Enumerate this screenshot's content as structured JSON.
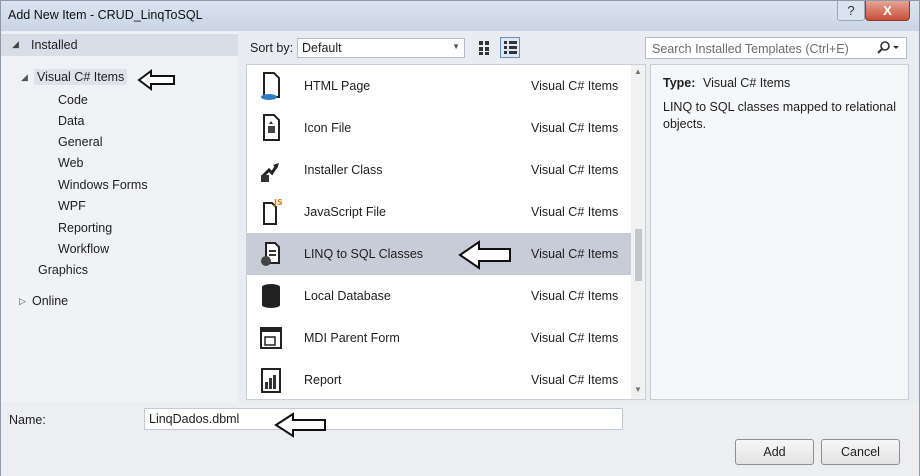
{
  "window": {
    "title": "Add New Item - CRUD_LinqToSQL",
    "help_label": "?",
    "close_label": "X"
  },
  "tree": {
    "installed_label": "Installed",
    "visual_csharp_label": "Visual C# Items",
    "children": [
      "Code",
      "Data",
      "General",
      "Web",
      "Windows Forms",
      "WPF",
      "Reporting",
      "Workflow"
    ],
    "graphics_label": "Graphics",
    "online_label": "Online"
  },
  "toolbar": {
    "sort_label": "Sort by:",
    "sort_value": "Default"
  },
  "search": {
    "placeholder": "Search Installed Templates (Ctrl+E)"
  },
  "templates": [
    {
      "name": "HTML Page",
      "type": "Visual C# Items",
      "icon": "html-page-icon"
    },
    {
      "name": "Icon File",
      "type": "Visual C# Items",
      "icon": "icon-file-icon"
    },
    {
      "name": "Installer Class",
      "type": "Visual C# Items",
      "icon": "installer-class-icon"
    },
    {
      "name": "JavaScript File",
      "type": "Visual C# Items",
      "icon": "javascript-file-icon"
    },
    {
      "name": "LINQ to SQL Classes",
      "type": "Visual C# Items",
      "icon": "linq-to-sql-icon",
      "selected": true
    },
    {
      "name": "Local Database",
      "type": "Visual C# Items",
      "icon": "database-icon"
    },
    {
      "name": "MDI Parent Form",
      "type": "Visual C# Items",
      "icon": "mdi-form-icon"
    },
    {
      "name": "Report",
      "type": "Visual C# Items",
      "icon": "report-icon"
    }
  ],
  "detail": {
    "type_label": "Type:",
    "type_value": "Visual C# Items",
    "description": "LINQ to SQL classes mapped to relational objects."
  },
  "bottom": {
    "name_label": "Name:",
    "name_value": "LinqDados.dbml",
    "add_label": "Add",
    "cancel_label": "Cancel"
  },
  "colors": {
    "selected_row": "#c8ccd6",
    "close_button": "#c7503a",
    "window_bg": "#e9ecf1"
  }
}
